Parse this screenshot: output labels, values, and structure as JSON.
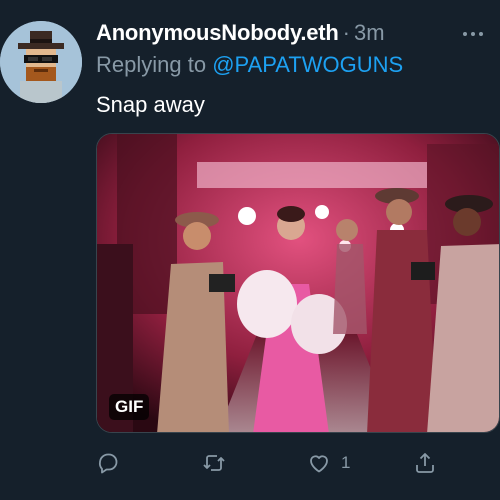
{
  "tweet": {
    "display_name": "AnonymousNobody.eth",
    "separator": "·",
    "time": "3m",
    "replying_prefix": "Replying to",
    "replying_handle": "@PAPATWOGUNS",
    "text": "Snap away",
    "media": {
      "badge": "GIF"
    },
    "actions": {
      "like_count": "1"
    }
  },
  "colors": {
    "background": "#15202b",
    "secondary_text": "#8899a6",
    "link": "#1da1f2"
  },
  "icons": [
    "more-icon",
    "reply-icon",
    "retweet-icon",
    "like-icon",
    "share-icon"
  ]
}
